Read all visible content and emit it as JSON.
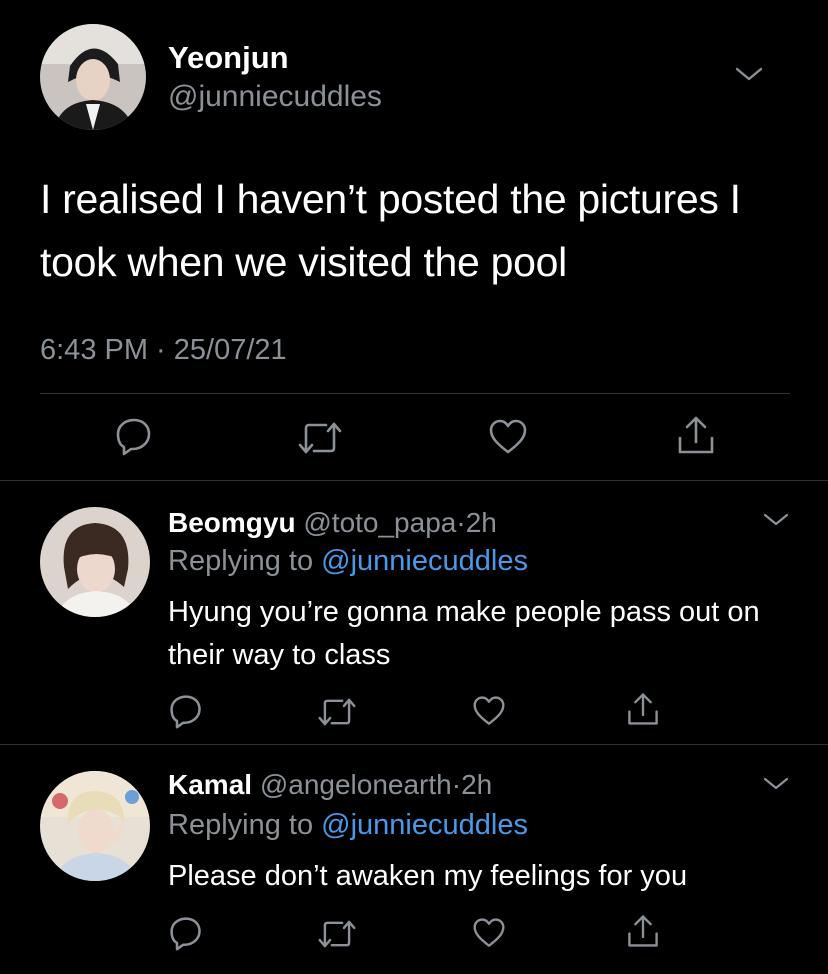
{
  "main_tweet": {
    "author_name": "Yeonjun",
    "author_handle": "@junniecuddles",
    "text": "I realised I haven’t posted the pictures I took when we visited the pool",
    "timestamp": "6:43 PM · 25/07/21",
    "actions": [
      "reply-icon",
      "retweet-icon",
      "like-icon",
      "share-icon"
    ]
  },
  "replies": [
    {
      "author_name": "Beomgyu",
      "author_handle": "@toto_papa",
      "dot": "·",
      "time": "2h",
      "replying_prefix": "Replying to ",
      "replying_to": "@junniecuddles",
      "text": "Hyung you’re gonna make people pass out on their way to class"
    },
    {
      "author_name": "Kamal",
      "author_handle": "@angelonearth",
      "dot": "·",
      "time": "2h",
      "replying_prefix": "Replying to ",
      "replying_to": "@junniecuddles",
      "text": "Please don’t awaken my feelings for you"
    }
  ],
  "colors": {
    "background": "#000000",
    "text": "#ffffff",
    "muted": "#8b9197",
    "link": "#4a99e9",
    "divider": "#2f3336"
  }
}
